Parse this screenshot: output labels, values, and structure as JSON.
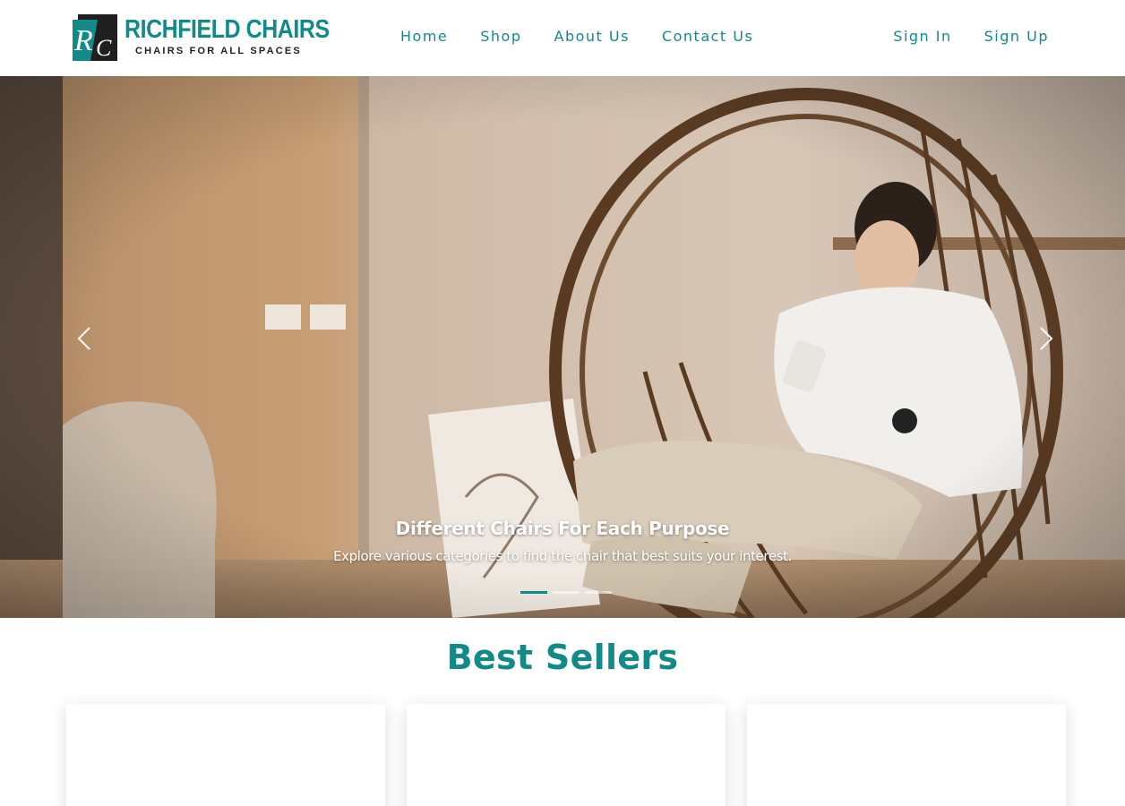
{
  "brand": {
    "name": "RICHFIELD CHAIRS",
    "tagline": "CHAIRS FOR ALL SPACES",
    "monogram": "RC",
    "color": "#138a8a"
  },
  "nav": {
    "items": [
      {
        "label": "Home"
      },
      {
        "label": "Shop"
      },
      {
        "label": "About Us"
      },
      {
        "label": "Contact Us"
      }
    ],
    "sign_in": "Sign In",
    "sign_up": "Sign Up"
  },
  "carousel": {
    "caption_title": "Different Chairs For Each Purpose",
    "caption_text": "Explore various categories to find the chair that best suits your interest.",
    "prev_icon": "chevron-left-icon",
    "next_icon": "chevron-right-icon",
    "slide_count": 3,
    "active_slide": 1
  },
  "best_sellers": {
    "title": "Best Sellers",
    "products": [
      {
        "image": "product-image"
      },
      {
        "image": "product-image"
      },
      {
        "image": "product-image"
      }
    ]
  }
}
